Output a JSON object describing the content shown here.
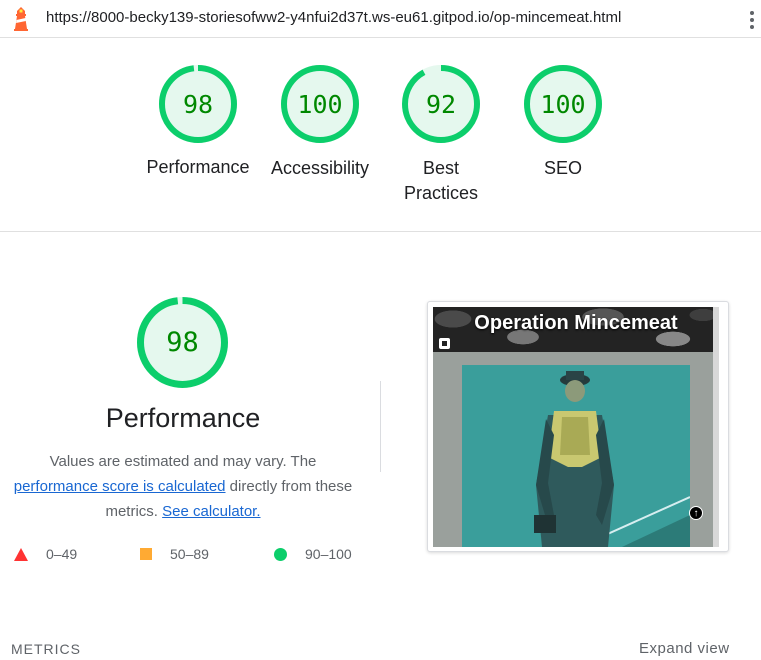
{
  "browser": {
    "url": "https://8000-becky139-storiesofww2-y4nfui2d37t.ws-eu61.gitpod.io/op-mincemeat.html",
    "menu_icon": "kebab-menu-icon"
  },
  "summary": {
    "gauges": [
      {
        "score": "98",
        "label": "Performance",
        "fraction": 0.98
      },
      {
        "score": "100",
        "label": "Accessibility",
        "fraction": 1.0
      },
      {
        "score": "92",
        "label": "Best Practices",
        "fraction": 0.92
      },
      {
        "score": "100",
        "label": "SEO",
        "fraction": 1.0
      }
    ]
  },
  "performance": {
    "score": "98",
    "fraction": 0.98,
    "title": "Performance",
    "desc_1": "Values are estimated and may vary. The",
    "desc_link1": "performance score is calculated",
    "desc_2": " directly from these metrics. ",
    "desc_link2": "See calculator.",
    "legend": [
      {
        "shape": "triangle",
        "range": "0–49",
        "color": "#ff3333"
      },
      {
        "shape": "square",
        "range": "50–89",
        "color": "#ffaa33"
      },
      {
        "shape": "circle",
        "range": "90–100",
        "color": "#0cce6b"
      }
    ]
  },
  "screenshot": {
    "title": "Operation Mincemeat"
  },
  "metrics": {
    "label": "METRICS",
    "expand": "Expand view"
  },
  "colors": {
    "pass_green": "#0cce6b",
    "pass_text": "#008800",
    "pass_fill": "#e5f8ee",
    "link": "#1967d2"
  }
}
